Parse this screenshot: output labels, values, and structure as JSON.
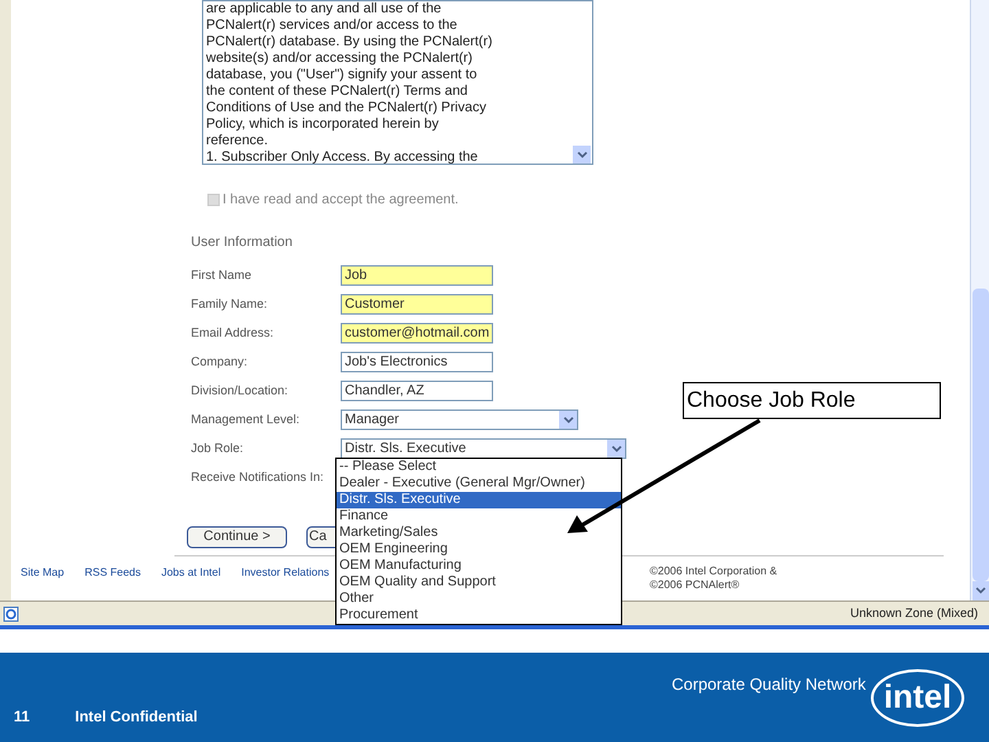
{
  "agreement": {
    "lines": [
      "are applicable to any and all use of the",
      "PCNalert(r) services and/or access to the",
      "PCNalert(r) database. By using the PCNalert(r)",
      "website(s) and/or accessing the PCNalert(r)",
      "database, you (\"User\") signify your assent to",
      "the content of these PCNalert(r) Terms and",
      "Conditions of Use and the PCNalert(r) Privacy",
      "Policy, which is incorporated herein by",
      "reference.",
      "1. Subscriber Only Access. By accessing the"
    ],
    "accept_label": "I have read and accept the agreement.",
    "accept_checked": false
  },
  "section_title": "User Information",
  "fields": [
    {
      "label": "First Name",
      "kind": "text",
      "value": "Job",
      "highlighted": true
    },
    {
      "label": "Family Name:",
      "kind": "text",
      "value": "Customer",
      "highlighted": true
    },
    {
      "label": "Email Address:",
      "kind": "text",
      "value": "customer@hotmail.com",
      "highlighted": true
    },
    {
      "label": "Company:",
      "kind": "text",
      "value": "Job's Electronics",
      "highlighted": false
    },
    {
      "label": "Division/Location:",
      "kind": "text",
      "value": "Chandler, AZ",
      "highlighted": false
    },
    {
      "label": "Management Level:",
      "kind": "select",
      "value": "Manager",
      "highlighted": false
    },
    {
      "label": "Job Role:",
      "kind": "select",
      "value": "Distr. Sls. Executive",
      "highlighted": false
    },
    {
      "label": "Receive Notifications In:",
      "kind": "label"
    }
  ],
  "dropdown_options": [
    {
      "label": "-- Please Select",
      "selected": false
    },
    {
      "label": "Dealer - Executive (General Mgr/Owner)",
      "selected": false
    },
    {
      "label": "Distr. Sls. Executive",
      "selected": true
    },
    {
      "label": "Finance",
      "selected": false
    },
    {
      "label": "Marketing/Sales",
      "selected": false
    },
    {
      "label": "OEM Engineering",
      "selected": false
    },
    {
      "label": "OEM Manufacturing",
      "selected": false
    },
    {
      "label": "OEM Quality and Support",
      "selected": false
    },
    {
      "label": "Other",
      "selected": false
    },
    {
      "label": "Procurement",
      "selected": false
    }
  ],
  "buttons": [
    "Continue >",
    "Ca"
  ],
  "footer_links": [
    "Site Map",
    "RSS Feeds",
    "Jobs at Intel",
    "Investor Relations"
  ],
  "copyright": [
    "©2006 Intel Corporation &",
    "©2006 PCNAlert®"
  ],
  "status_bar": {
    "zone": "Unknown Zone (Mixed)"
  },
  "callout": "Choose Job Role",
  "slide_footer": {
    "page": "11",
    "confidential": "Intel Confidential",
    "network": "Corporate Quality Network",
    "logo": "intel"
  }
}
